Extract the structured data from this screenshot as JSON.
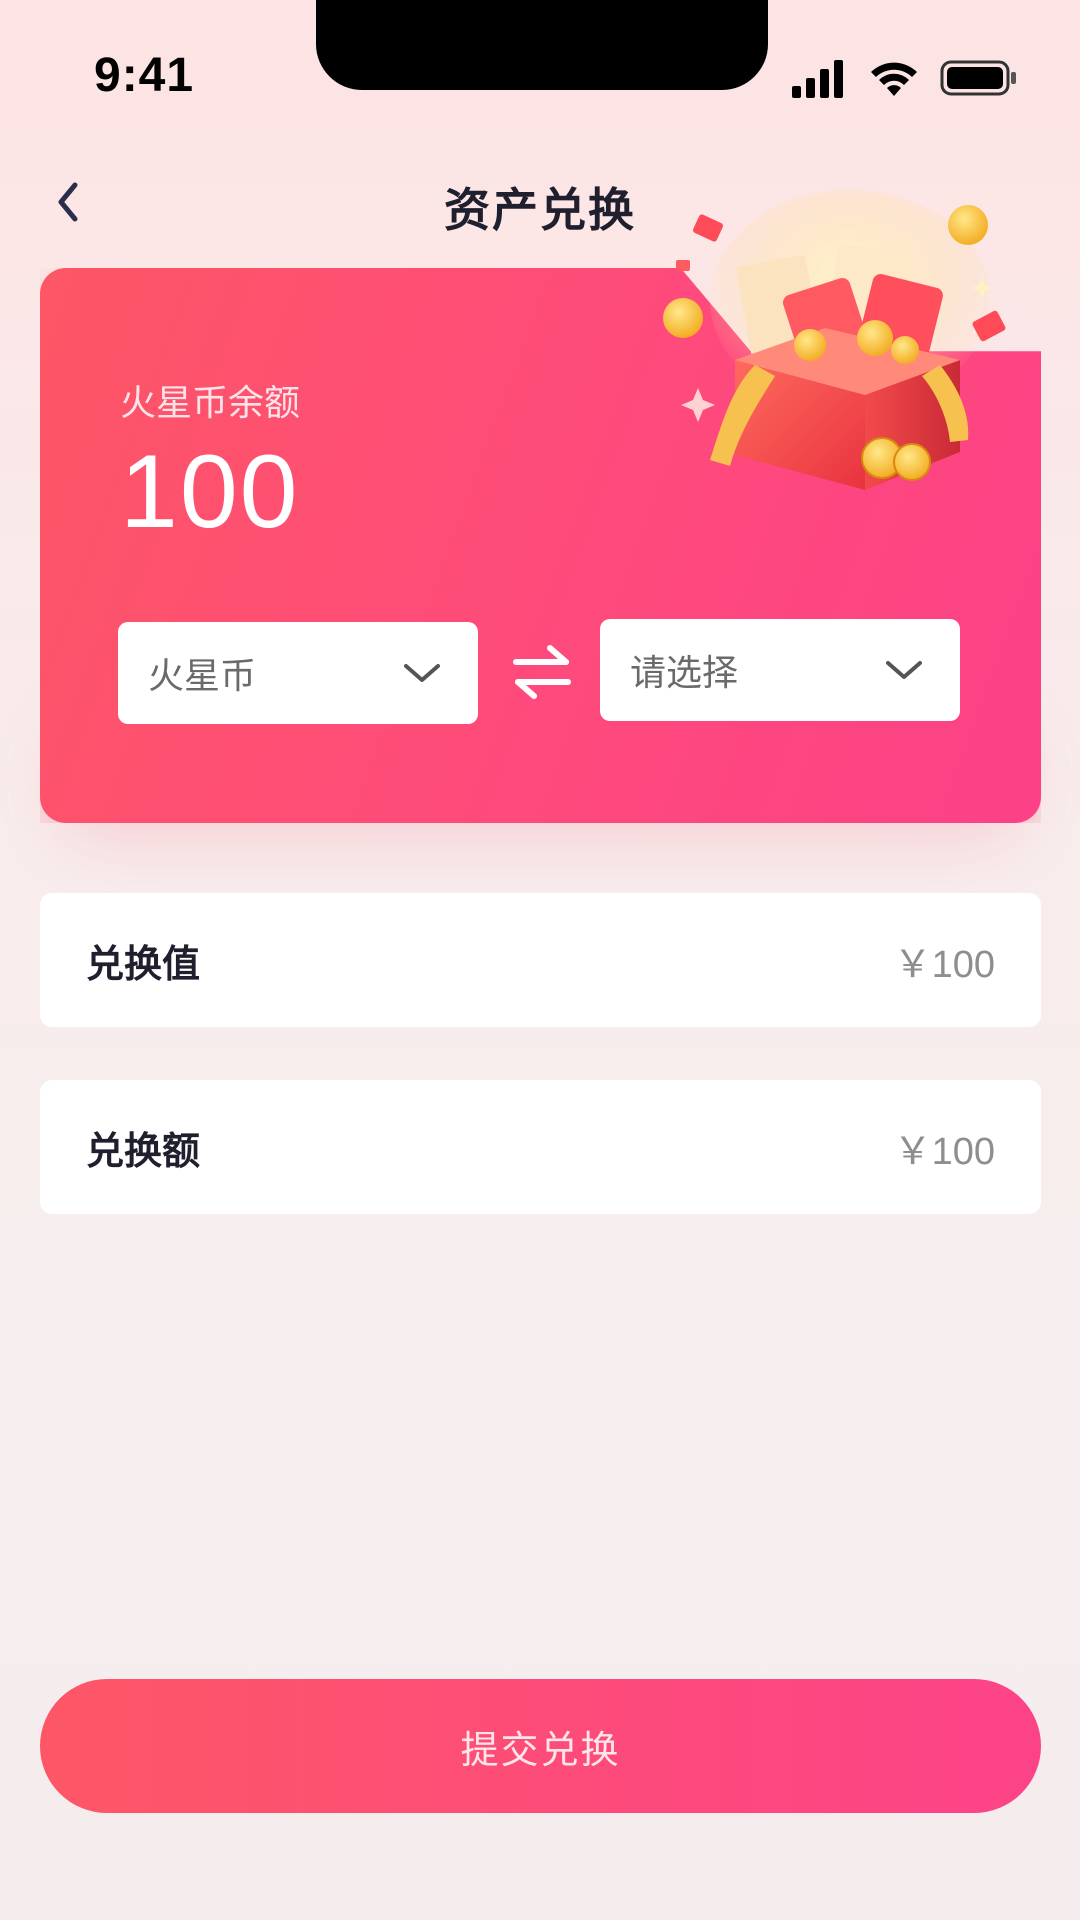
{
  "status_bar": {
    "time": "9:41"
  },
  "nav": {
    "title": "资产兑换"
  },
  "card": {
    "balance_label": "火星币余额",
    "balance_value": "100",
    "from_select": "火星币",
    "to_select": "请选择"
  },
  "rows": [
    {
      "label": "兑换值",
      "value": "￥100"
    },
    {
      "label": "兑换额",
      "value": "￥100"
    }
  ],
  "submit": {
    "label": "提交兑换"
  },
  "colors": {
    "accent_start": "#fd5665",
    "accent_end": "#fc4187",
    "background": "#f6eeee"
  },
  "icons": {
    "back": "chevron-left-icon",
    "dropdown": "chevron-down-icon",
    "swap": "swap-arrows-icon",
    "gift": "gift-box-illustration"
  }
}
